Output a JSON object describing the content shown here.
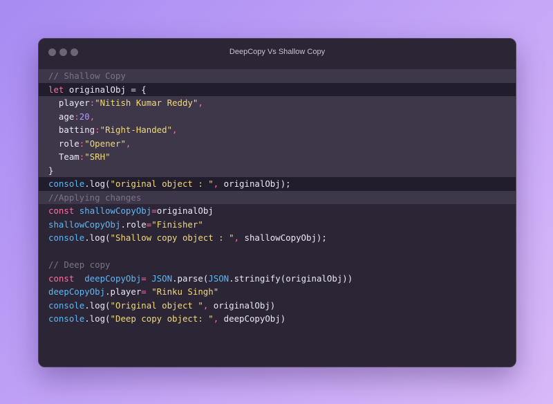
{
  "window": {
    "title": "DeepCopy Vs Shallow Copy"
  },
  "code": {
    "l1": "// Shallow Copy",
    "l2_kw": "let",
    "l2_name": " originalObj = {",
    "l3_key": "  player",
    "l3_colon": ":",
    "l3_val": "\"Nitish Kumar Reddy\"",
    "l3_comma": ",",
    "l4_key": "  age",
    "l4_colon": ":",
    "l4_val": "20",
    "l4_comma": ",",
    "l5_key": "  batting",
    "l5_colon": ":",
    "l5_val": "\"Right-Handed\"",
    "l5_comma": ",",
    "l6_key": "  role",
    "l6_colon": ":",
    "l6_val": "\"Opener\"",
    "l6_comma": ",",
    "l7_key": "  Team",
    "l7_colon": ":",
    "l7_val": "\"SRH\"",
    "l8": "}",
    "l9_obj": "console",
    "l9_fn": ".log(",
    "l9_str": "\"original object : \"",
    "l9_comma": ", ",
    "l9_arg": "originalObj);",
    "l10": "//Applying changes",
    "l11_kw": "const",
    "l11_name": " shallowCopyObj",
    "l11_eq": "=",
    "l11_val": "originalObj",
    "l12_obj": "shallowCopyObj",
    "l12_prop": ".role",
    "l12_eq": "=",
    "l12_val": "\"Finisher\"",
    "l13_obj": "console",
    "l13_fn": ".log(",
    "l13_str": "\"Shallow copy object : \"",
    "l13_comma": ", ",
    "l13_arg": "shallowCopyObj);",
    "l15": "// Deep copy",
    "l16_kw": "const",
    "l16_name": "  deepCopyObj",
    "l16_eq": "= ",
    "l16_json1": "JSON",
    "l16_parse": ".parse(",
    "l16_json2": "JSON",
    "l16_stringify": ".stringify",
    "l16_arg": "(originalObj))",
    "l17_obj": "deepCopyObj",
    "l17_prop": ".player",
    "l17_eq": "= ",
    "l17_val": "\"Rinku Singh\"",
    "l18_obj": "console",
    "l18_fn": ".log(",
    "l18_str": "\"Original object \"",
    "l18_comma": ", ",
    "l18_arg": "originalObj)",
    "l19_obj": "console",
    "l19_fn": ".log(",
    "l19_str": "\"Deep copy object: \"",
    "l19_comma": ", ",
    "l19_arg": "deepCopyObj)"
  }
}
